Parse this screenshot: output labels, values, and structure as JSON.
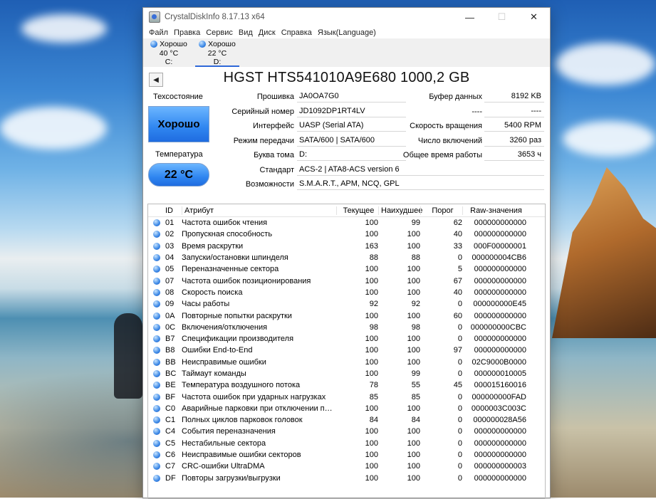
{
  "window": {
    "title": "CrystalDiskInfo 8.17.13 x64",
    "controls": {
      "minimize": "—",
      "maximize": "☐",
      "close": "✕"
    }
  },
  "menu": [
    "Файл",
    "Правка",
    "Сервис",
    "Вид",
    "Диск",
    "Справка",
    "Язык(Language)"
  ],
  "disks": [
    {
      "status": "Хорошо",
      "temp": "40 °C",
      "letter": "C:"
    },
    {
      "status": "Хорошо",
      "temp": "22 °C",
      "letter": "D:"
    }
  ],
  "disk_title": "HGST HTS541010A9E680 1000,2 GB",
  "health": {
    "label": "Техсостояние",
    "value": "Хорошо"
  },
  "temperature": {
    "label": "Температура",
    "value": "22 °C"
  },
  "info": {
    "firmware_label": "Прошивка",
    "firmware": "JA0OA7G0",
    "serial_label": "Серийный номер",
    "serial": "JD1092DP1RT4LV",
    "interface_label": "Интерфейс",
    "interface": "UASP (Serial ATA)",
    "transfer_label": "Режим передачи",
    "transfer": "SATA/600 | SATA/600",
    "volume_label": "Буква тома",
    "volume": "D:",
    "standard_label": "Стандарт",
    "standard": "ACS-2 | ATA8-ACS version 6",
    "features_label": "Возможности",
    "features": "S.M.A.R.T., APM, NCQ, GPL",
    "buffer_label": "Буфер данных",
    "buffer": "8192 KB",
    "blank_label": "----",
    "blank": "----",
    "rotation_label": "Скорость вращения",
    "rotation": "5400 RPM",
    "power_count_label": "Число включений",
    "power_count": "3260 раз",
    "power_hours_label": "Общее время работы",
    "power_hours": "3653 ч"
  },
  "smart": {
    "headers": {
      "id": "ID",
      "name": "Атрибут",
      "current": "Текущее",
      "worst": "Наихудшее",
      "threshold": "Порог",
      "raw": "Raw-значения"
    },
    "rows": [
      {
        "id": "01",
        "name": "Частота ошибок чтения",
        "current": "100",
        "worst": "99",
        "threshold": "62",
        "raw": "000000000000"
      },
      {
        "id": "02",
        "name": "Пропускная способность",
        "current": "100",
        "worst": "100",
        "threshold": "40",
        "raw": "000000000000"
      },
      {
        "id": "03",
        "name": "Время раскрутки",
        "current": "163",
        "worst": "100",
        "threshold": "33",
        "raw": "000F00000001"
      },
      {
        "id": "04",
        "name": "Запуски/остановки шпинделя",
        "current": "88",
        "worst": "88",
        "threshold": "0",
        "raw": "000000004CB6"
      },
      {
        "id": "05",
        "name": "Переназначенные сектора",
        "current": "100",
        "worst": "100",
        "threshold": "5",
        "raw": "000000000000"
      },
      {
        "id": "07",
        "name": "Частота ошибок позиционирования",
        "current": "100",
        "worst": "100",
        "threshold": "67",
        "raw": "000000000000"
      },
      {
        "id": "08",
        "name": "Скорость поиска",
        "current": "100",
        "worst": "100",
        "threshold": "40",
        "raw": "000000000000"
      },
      {
        "id": "09",
        "name": "Часы работы",
        "current": "92",
        "worst": "92",
        "threshold": "0",
        "raw": "000000000E45"
      },
      {
        "id": "0A",
        "name": "Повторные попытки раскрутки",
        "current": "100",
        "worst": "100",
        "threshold": "60",
        "raw": "000000000000"
      },
      {
        "id": "0C",
        "name": "Включения/отключения",
        "current": "98",
        "worst": "98",
        "threshold": "0",
        "raw": "000000000CBC"
      },
      {
        "id": "B7",
        "name": "Спецификации производителя",
        "current": "100",
        "worst": "100",
        "threshold": "0",
        "raw": "000000000000"
      },
      {
        "id": "B8",
        "name": "Ошибки End-to-End",
        "current": "100",
        "worst": "100",
        "threshold": "97",
        "raw": "000000000000"
      },
      {
        "id": "BB",
        "name": "Неисправимые ошибки",
        "current": "100",
        "worst": "100",
        "threshold": "0",
        "raw": "02C9000B0000"
      },
      {
        "id": "BC",
        "name": "Таймаут команды",
        "current": "100",
        "worst": "99",
        "threshold": "0",
        "raw": "000000010005"
      },
      {
        "id": "BE",
        "name": "Температура воздушного потока",
        "current": "78",
        "worst": "55",
        "threshold": "45",
        "raw": "000015160016"
      },
      {
        "id": "BF",
        "name": "Частота ошибок при ударных нагрузках",
        "current": "85",
        "worst": "85",
        "threshold": "0",
        "raw": "000000000FAD"
      },
      {
        "id": "C0",
        "name": "Аварийные парковки при отключении пит...",
        "current": "100",
        "worst": "100",
        "threshold": "0",
        "raw": "0000003C003C"
      },
      {
        "id": "C1",
        "name": "Полных циклов парковок головок",
        "current": "84",
        "worst": "84",
        "threshold": "0",
        "raw": "000000028A56"
      },
      {
        "id": "C4",
        "name": "События переназначения",
        "current": "100",
        "worst": "100",
        "threshold": "0",
        "raw": "000000000000"
      },
      {
        "id": "C5",
        "name": "Нестабильные сектора",
        "current": "100",
        "worst": "100",
        "threshold": "0",
        "raw": "000000000000"
      },
      {
        "id": "C6",
        "name": "Неисправимые ошибки секторов",
        "current": "100",
        "worst": "100",
        "threshold": "0",
        "raw": "000000000000"
      },
      {
        "id": "C7",
        "name": "CRC-ошибки UltraDMA",
        "current": "100",
        "worst": "100",
        "threshold": "0",
        "raw": "000000000003"
      },
      {
        "id": "DF",
        "name": "Повторы загрузки/выгрузки",
        "current": "100",
        "worst": "100",
        "threshold": "0",
        "raw": "000000000000"
      }
    ]
  }
}
